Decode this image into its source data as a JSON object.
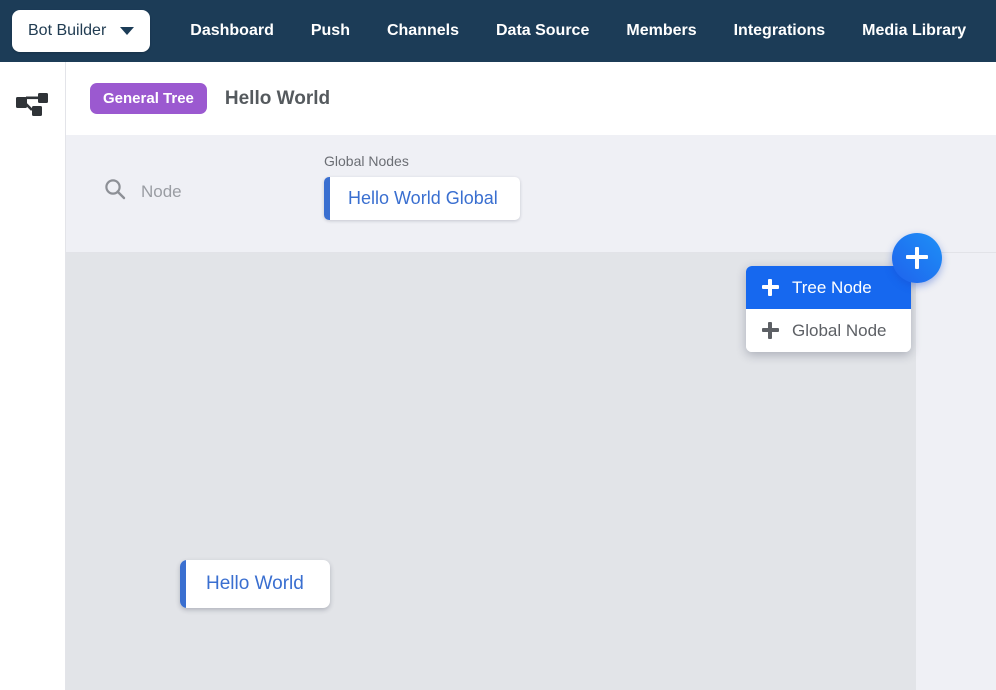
{
  "topnav": {
    "brand": {
      "label": "Bot Builder",
      "caret_icon": "chevron-down-icon"
    },
    "links": [
      {
        "label": "Dashboard"
      },
      {
        "label": "Push"
      },
      {
        "label": "Channels"
      },
      {
        "label": "Data Source"
      },
      {
        "label": "Members"
      },
      {
        "label": "Integrations"
      },
      {
        "label": "Media Library"
      }
    ],
    "background_color": "#1c3c57"
  },
  "rail": {
    "icon": "tree-hierarchy-icon"
  },
  "breadcrumb": {
    "badge": "General Tree",
    "badge_color": "#9b59d0",
    "title": "Hello World"
  },
  "filter_band": {
    "search": {
      "icon": "search-icon",
      "placeholder": "Node",
      "value": ""
    },
    "global_nodes": {
      "label": "Global Nodes",
      "items": [
        {
          "label": "Hello World Global",
          "accent_color": "#3a6fd0"
        }
      ]
    }
  },
  "canvas": {
    "nodes": [
      {
        "label": "Hello World",
        "accent_color": "#3a6fd0"
      }
    ],
    "background_color": "#e2e4e8"
  },
  "fab": {
    "icon": "plus-icon",
    "accent_color": "#1f62ec",
    "menu": [
      {
        "label": "Tree Node",
        "icon": "plus-icon",
        "active": true
      },
      {
        "label": "Global Node",
        "icon": "plus-icon",
        "active": false
      }
    ]
  }
}
